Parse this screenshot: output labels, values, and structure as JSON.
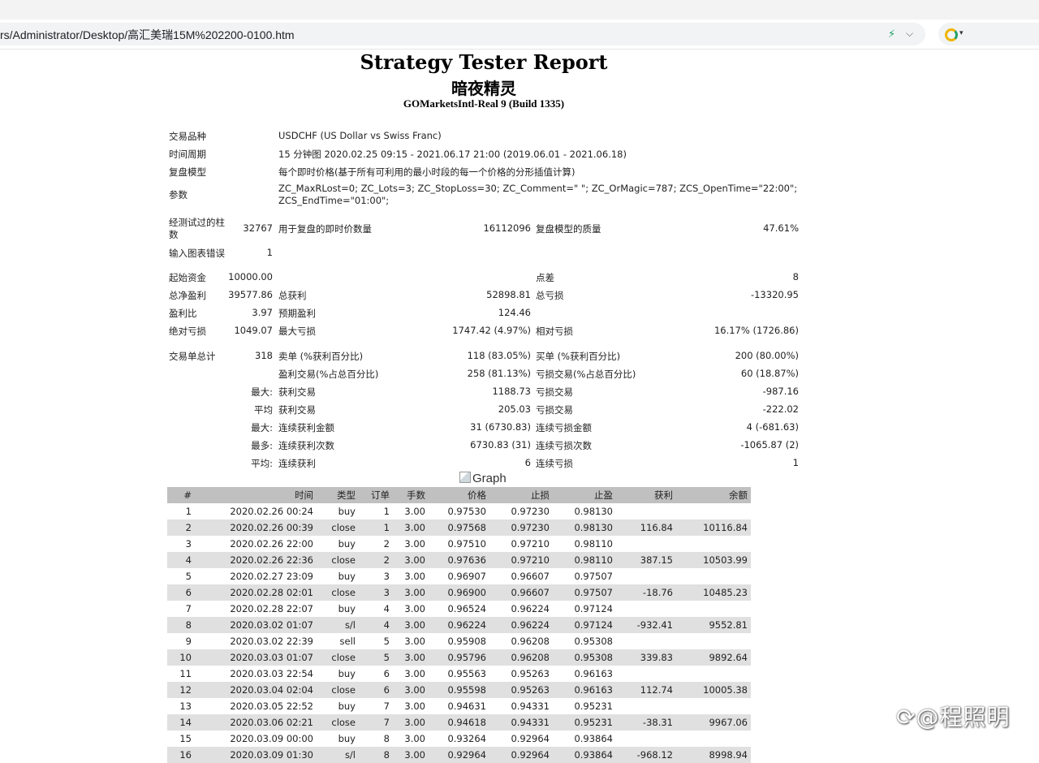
{
  "browser": {
    "url": "rs/Administrator/Desktop/高汇美瑞15M%202200-0100.htm"
  },
  "report": {
    "title": "Strategy Tester Report",
    "ea_name": "暗夜精灵",
    "server": "GOMarketsIntl-Real 9 (Build 1335)"
  },
  "settings": {
    "symbol_label": "交易品种",
    "symbol_value": "USDCHF (US Dollar vs Swiss Franc)",
    "period_label": "时间周期",
    "period_value": "15 分钟图 2020.02.25 09:15 - 2021.06.17 21:00 (2019.06.01 - 2021.06.18)",
    "model_label": "复盘模型",
    "model_value": "每个即时价格(基于所有可利用的最小时段的每一个价格的分形插值计算)",
    "params_label": "参数",
    "params_line1": "ZC_MaxRLost=0; ZC_Lots=3; ZC_StopLoss=30; ZC_Comment=\" \"; ZC_OrMagic=787; ZCS_OpenTime=\"22:00\";",
    "params_line2": "ZCS_EndTime=\"01:00\";"
  },
  "stats": {
    "bars_label_1": "经测试过的柱",
    "bars_label_2": "数",
    "bars_value": "32767",
    "ticks_label": "用于复盘的即时价数量",
    "ticks_value": "16112096",
    "quality_label": "复盘模型的质量",
    "quality_value": "47.61%",
    "errors_label": "输入图表错误",
    "errors_value": "1",
    "deposit_label": "起始资金",
    "deposit_value": "10000.00",
    "spread_label": "点差",
    "spread_value": "8",
    "net_label": "总净盈利",
    "net_value": "39577.86",
    "gross_profit_label": "总获利",
    "gross_profit_value": "52898.81",
    "gross_loss_label": "总亏损",
    "gross_loss_value": "-13320.95",
    "pf_label": "盈利比",
    "pf_value": "3.97",
    "expected_label": "预期盈利",
    "expected_value": "124.46",
    "abs_dd_label": "绝对亏损",
    "abs_dd_value": "1049.07",
    "max_dd_label": "最大亏损",
    "max_dd_value": "1747.42 (4.97%)",
    "rel_dd_label": "相对亏损",
    "rel_dd_value": "16.17% (1726.86)",
    "total_label": "交易单总计",
    "total_value": "318",
    "short_label": "卖单 (%获利百分比)",
    "short_value": "118 (83.05%)",
    "long_label": "买单 (%获利百分比)",
    "long_value": "200 (80.00%)",
    "profit_trades_label": "盈利交易(%占总百分比)",
    "profit_trades_value": "258 (81.13%)",
    "loss_trades_label": "亏损交易(%占总百分比)",
    "loss_trades_value": "60 (18.87%)",
    "largest_prefix": "最大:",
    "largest_profit_label": "获利交易",
    "largest_profit_value": "1188.73",
    "largest_loss_label": "亏损交易",
    "largest_loss_value": "-987.16",
    "average_prefix": "平均",
    "average_profit_label": "获利交易",
    "average_profit_value": "205.03",
    "average_loss_label": "亏损交易",
    "average_loss_value": "-222.02",
    "maxcons_prefix": "最大:",
    "maxcons_win_label": "连续获利金额",
    "maxcons_win_value": "31 (6730.83)",
    "maxcons_loss_label": "连续亏损金额",
    "maxcons_loss_value": "4 (-681.63)",
    "maxamt_prefix": "最多:",
    "maxamt_win_label": "连续获利次数",
    "maxamt_win_value": "6730.83 (31)",
    "maxamt_loss_label": "连续亏损次数",
    "maxamt_loss_value": "-1065.87 (2)",
    "avgcons_prefix": "平均:",
    "avgcons_win_label": "连续获利",
    "avgcons_win_value": "6",
    "avgcons_loss_label": "连续亏损",
    "avgcons_loss_value": "1"
  },
  "graph_alt": "Graph",
  "table": {
    "headers": [
      "#",
      "时间",
      "类型",
      "订单",
      "手数",
      "价格",
      "止损",
      "止盈",
      "获利",
      "余额"
    ],
    "rows": [
      [
        "1",
        "2020.02.26 00:24",
        "buy",
        "1",
        "3.00",
        "0.97530",
        "0.97230",
        "0.98130",
        "",
        ""
      ],
      [
        "2",
        "2020.02.26 00:39",
        "close",
        "1",
        "3.00",
        "0.97568",
        "0.97230",
        "0.98130",
        "116.84",
        "10116.84"
      ],
      [
        "3",
        "2020.02.26 22:00",
        "buy",
        "2",
        "3.00",
        "0.97510",
        "0.97210",
        "0.98110",
        "",
        ""
      ],
      [
        "4",
        "2020.02.26 22:36",
        "close",
        "2",
        "3.00",
        "0.97636",
        "0.97210",
        "0.98110",
        "387.15",
        "10503.99"
      ],
      [
        "5",
        "2020.02.27 23:09",
        "buy",
        "3",
        "3.00",
        "0.96907",
        "0.96607",
        "0.97507",
        "",
        ""
      ],
      [
        "6",
        "2020.02.28 02:01",
        "close",
        "3",
        "3.00",
        "0.96900",
        "0.96607",
        "0.97507",
        "-18.76",
        "10485.23"
      ],
      [
        "7",
        "2020.02.28 22:07",
        "buy",
        "4",
        "3.00",
        "0.96524",
        "0.96224",
        "0.97124",
        "",
        ""
      ],
      [
        "8",
        "2020.03.02 01:07",
        "s/l",
        "4",
        "3.00",
        "0.96224",
        "0.96224",
        "0.97124",
        "-932.41",
        "9552.81"
      ],
      [
        "9",
        "2020.03.02 22:39",
        "sell",
        "5",
        "3.00",
        "0.95908",
        "0.96208",
        "0.95308",
        "",
        ""
      ],
      [
        "10",
        "2020.03.03 01:07",
        "close",
        "5",
        "3.00",
        "0.95796",
        "0.96208",
        "0.95308",
        "339.83",
        "9892.64"
      ],
      [
        "11",
        "2020.03.03 22:54",
        "buy",
        "6",
        "3.00",
        "0.95563",
        "0.95263",
        "0.96163",
        "",
        ""
      ],
      [
        "12",
        "2020.03.04 02:04",
        "close",
        "6",
        "3.00",
        "0.95598",
        "0.95263",
        "0.96163",
        "112.74",
        "10005.38"
      ],
      [
        "13",
        "2020.03.05 22:52",
        "buy",
        "7",
        "3.00",
        "0.94631",
        "0.94331",
        "0.95231",
        "",
        ""
      ],
      [
        "14",
        "2020.03.06 02:21",
        "close",
        "7",
        "3.00",
        "0.94618",
        "0.94331",
        "0.95231",
        "-38.31",
        "9967.06"
      ],
      [
        "15",
        "2020.03.09 00:00",
        "buy",
        "8",
        "3.00",
        "0.93264",
        "0.92964",
        "0.93864",
        "",
        ""
      ],
      [
        "16",
        "2020.03.09 01:30",
        "s/l",
        "8",
        "3.00",
        "0.92964",
        "0.92964",
        "0.93864",
        "-968.12",
        "8998.94"
      ]
    ]
  },
  "watermark": "@程照明"
}
